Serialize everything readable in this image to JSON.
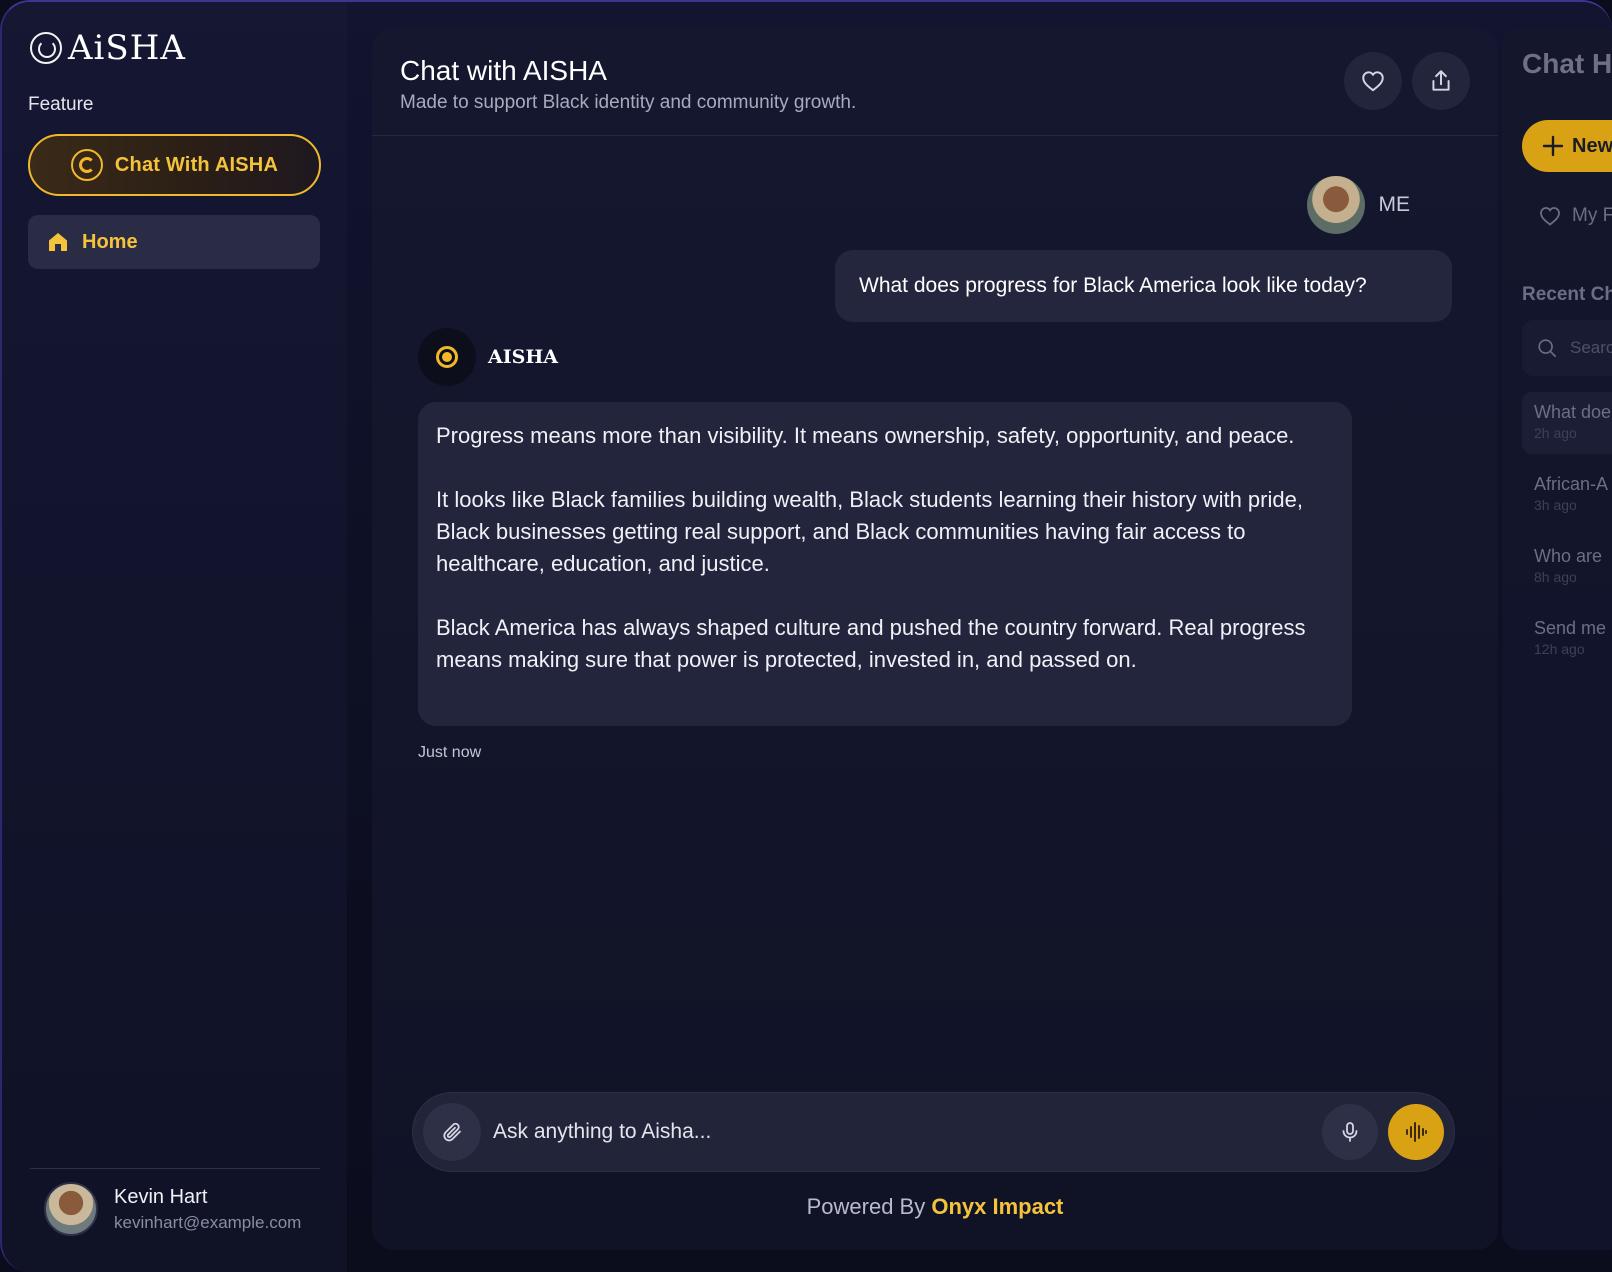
{
  "app": {
    "name": "AiSHA"
  },
  "sidebar": {
    "section_label": "Feature",
    "items": [
      {
        "label": "Chat With AISHA",
        "icon": "aisha-logo-icon",
        "active": true
      },
      {
        "label": "Home",
        "icon": "home-icon"
      }
    ],
    "user": {
      "name": "Kevin Hart",
      "email": "kevinhart@example.com"
    }
  },
  "main": {
    "title": "Chat with AISHA",
    "subtitle": "Made to support Black identity and community growth.",
    "user_label": "ME",
    "user_message": "What does progress for Black America look like today?",
    "bot_name": "AISHA",
    "bot_paragraphs": [
      "Progress means more than visibility. It means ownership, safety, opportunity, and peace.",
      "It looks like Black families building wealth, Black students learning their history with pride, Black businesses getting real support, and Black communities having fair access to healthcare, education, and justice.",
      "Black America has always shaped culture and pushed the country forward. Real progress means making sure that power is protected, invested in, and passed on."
    ],
    "timestamp": "Just now",
    "composer_placeholder": "Ask anything to Aisha...",
    "powered_prefix": "Powered By",
    "powered_brand": "Onyx Impact"
  },
  "right_panel": {
    "title": "Chat H",
    "new_label": "New",
    "favorites_label": "My F",
    "recent_label": "Recent Ch",
    "search_placeholder": "Searc",
    "recent": [
      {
        "title": "What doe",
        "time": "2h ago"
      },
      {
        "title": "African-A",
        "time": "3h ago"
      },
      {
        "title": "Who are",
        "time": "8h ago"
      },
      {
        "title": "Send me",
        "time": "12h ago"
      }
    ]
  },
  "colors": {
    "accent": "#f5c33b",
    "accent_dark": "#d9a214",
    "background": "#0b0c1c",
    "card": "#23253d"
  }
}
